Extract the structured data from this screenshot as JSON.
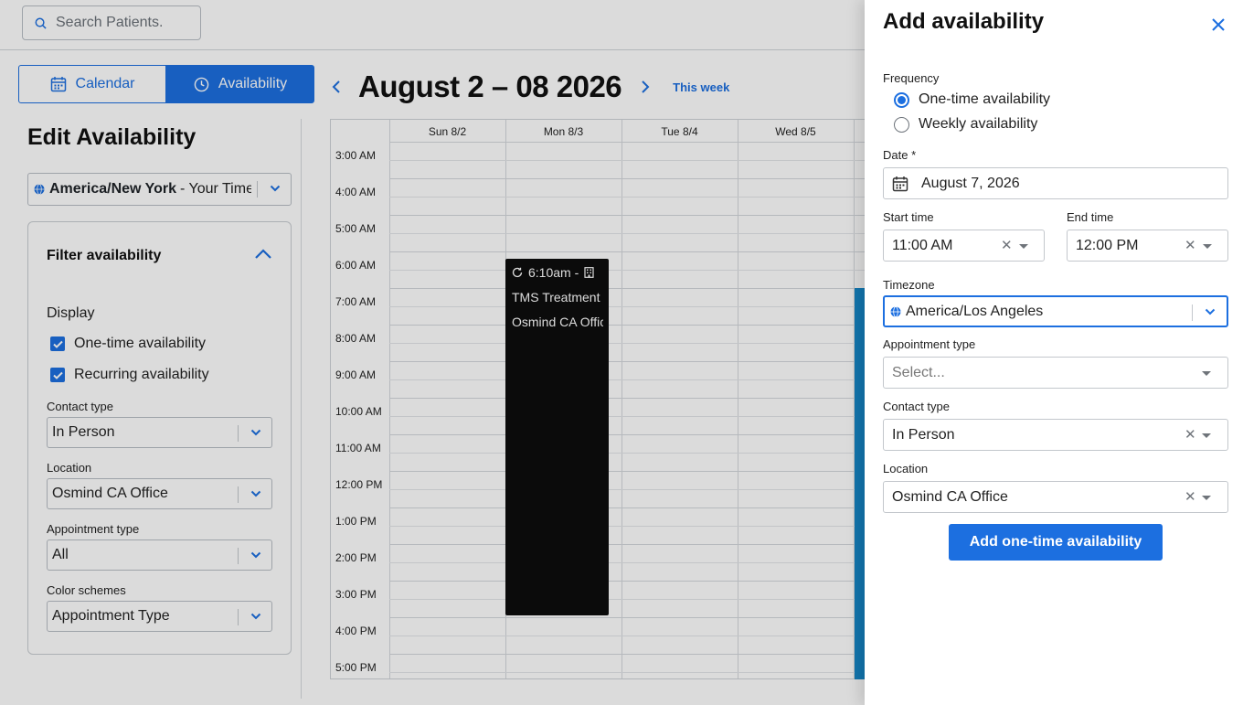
{
  "search": {
    "placeholder": "Search Patients."
  },
  "view_toggle": {
    "calendar_label": "Calendar",
    "availability_label": "Availability"
  },
  "week_nav": {
    "title": "August 2 – 08 2026",
    "this_week_label": "This week"
  },
  "left_panel": {
    "title": "Edit Availability",
    "timezone": {
      "bold": "America/New York",
      "rest": " - Your Timezone"
    },
    "filter": {
      "title": "Filter availability",
      "display_label": "Display",
      "checkboxes": [
        {
          "label": "One-time availability",
          "checked": true
        },
        {
          "label": "Recurring availability",
          "checked": true
        }
      ],
      "fields": [
        {
          "label": "Contact type",
          "value": "In Person"
        },
        {
          "label": "Location",
          "value": "Osmind CA Office"
        },
        {
          "label": "Appointment type",
          "value": "All"
        },
        {
          "label": "Color schemes",
          "value": "Appointment Type"
        }
      ]
    }
  },
  "calendar": {
    "days": [
      "Sun 8/2",
      "Mon 8/3",
      "Tue 8/4",
      "Wed 8/5"
    ],
    "times": [
      "3:00 AM",
      "4:00 AM",
      "5:00 AM",
      "6:00 AM",
      "7:00 AM",
      "8:00 AM",
      "9:00 AM",
      "10:00 AM",
      "11:00 AM",
      "12:00 PM",
      "1:00 PM",
      "2:00 PM",
      "3:00 PM",
      "4:00 PM",
      "5:00 PM"
    ],
    "event": {
      "time": "6:10am -",
      "line1": "TMS Treatment",
      "line2": "Osmind CA Office",
      "color": "#0d0d0d"
    }
  },
  "drawer": {
    "title": "Add availability",
    "frequency_label": "Frequency",
    "frequency_options": [
      {
        "label": "One-time availability",
        "selected": true
      },
      {
        "label": "Weekly availability",
        "selected": false
      }
    ],
    "date_label": "Date *",
    "date_value": "August 7, 2026",
    "start_time_label": "Start time",
    "start_time_value": "11:00 AM",
    "end_time_label": "End time",
    "end_time_value": "12:00 PM",
    "timezone_label": "Timezone",
    "timezone_value": "America/Los Angeles",
    "appointment_type_label": "Appointment type",
    "appointment_type_placeholder": "Select...",
    "contact_type_label": "Contact type",
    "contact_type_value": "In Person",
    "location_label": "Location",
    "location_value": "Osmind CA Office",
    "submit_label": "Add one-time availability"
  },
  "colors": {
    "accent": "#1c6fe0",
    "event_blue": "#1688c9"
  }
}
